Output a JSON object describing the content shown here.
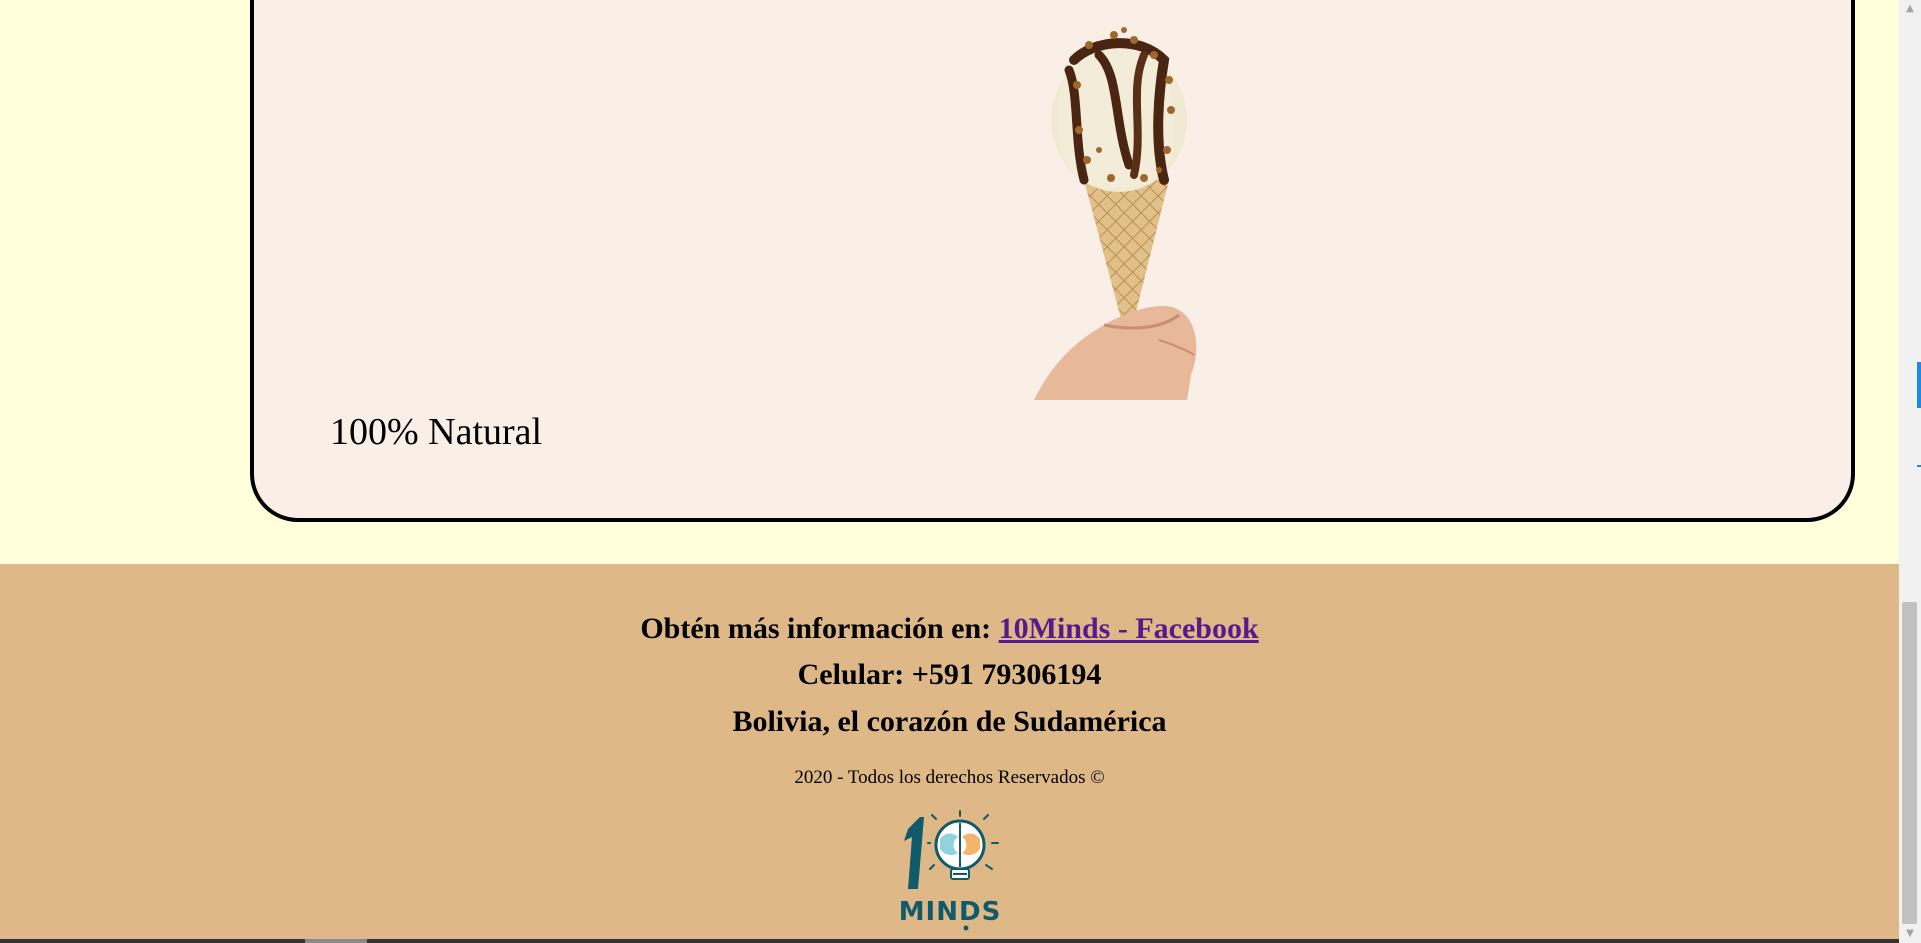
{
  "product": {
    "caption": "100% Natural",
    "image": "ice-cream-cone-with-chocolate-and-nuts"
  },
  "footer": {
    "info_prefix": "Obtén más información en:",
    "facebook_link": "10Minds - Facebook",
    "phone": "Celular: +591 79306194",
    "tagline": "Bolivia, el corazón de Sudamérica",
    "copyright": "2020 - Todos los derechos Reservados ©",
    "logo_text": "10 MINDS"
  },
  "colors": {
    "page_bg": "#ffffdc",
    "card_bg": "#faefe7",
    "footer_bg": "#deb887",
    "link": "#551a8b",
    "logo_teal": "#0f5a6b"
  },
  "scrollbar": {
    "up_icon": "arrow-up-icon",
    "down_icon": "arrow-down-icon"
  }
}
